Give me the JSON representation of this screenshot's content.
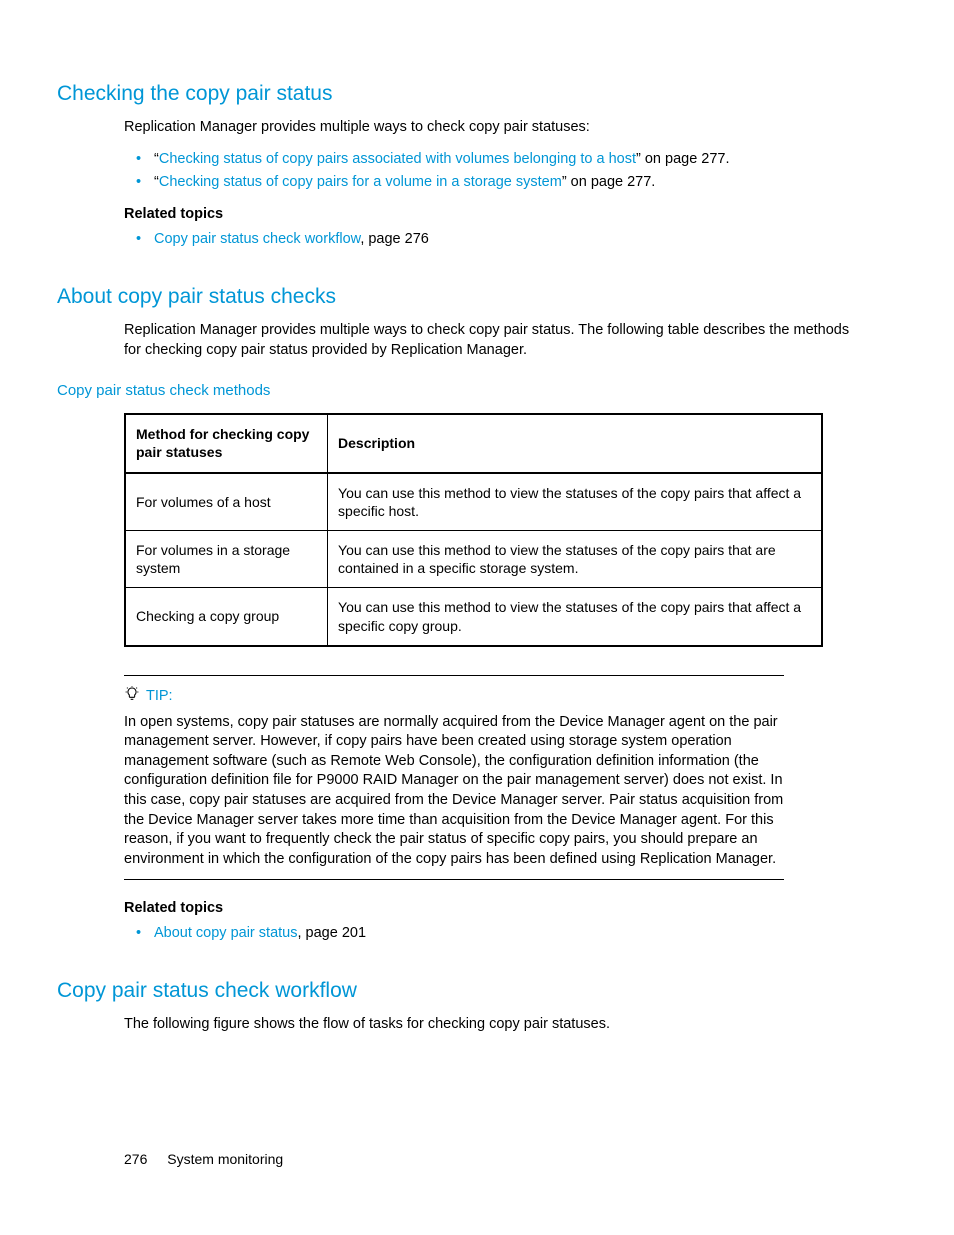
{
  "sec1": {
    "heading": "Checking the copy pair status",
    "intro": "Replication Manager provides multiple ways to check copy pair statuses:",
    "bullets": [
      {
        "pre": "“",
        "link": "Checking status of copy pairs associated with volumes belonging to a host",
        "post": "” on page 277."
      },
      {
        "pre": "“",
        "link": "Checking status of copy pairs for a volume in a storage system",
        "post": "” on page 277."
      }
    ],
    "rt_heading": "Related topics",
    "rt_items": [
      {
        "link": "Copy pair status check workflow",
        "post": ", page 276"
      }
    ]
  },
  "sec2": {
    "heading": "About copy pair status checks",
    "intro": "Replication Manager provides multiple ways to check copy pair status. The following table describes the methods for checking copy pair status provided by Replication Manager.",
    "table_caption": "Copy pair status check methods",
    "table": {
      "h1": "Method for checking copy pair statuses",
      "h2": "Description",
      "rows": [
        {
          "c1": "For volumes of a host",
          "c2": "You can use this method to view the statuses of the copy pairs that affect a specific host."
        },
        {
          "c1": "For volumes in a storage system",
          "c2": "You can use this method to view the statuses of the copy pairs that are contained in a specific storage system."
        },
        {
          "c1": "Checking a copy group",
          "c2": "You can use this method to view the statuses of the copy pairs that affect a specific copy group."
        }
      ]
    },
    "tip_label": "TIP:",
    "tip_text": "In open systems, copy pair statuses are normally acquired from the Device Manager agent on the pair management server. However, if copy pairs have been created using storage system operation management software (such as Remote Web Console), the configuration definition information (the configuration definition file for P9000 RAID Manager on the pair management server) does not exist. In this case, copy pair statuses are acquired from the Device Manager server. Pair status acquisition from the Device Manager server takes more time than acquisition from the Device Manager agent. For this reason, if you want to frequently check the pair status of specific copy pairs, you should prepare an environment in which the configuration of the copy pairs has been defined using Replication Manager.",
    "rt_heading": "Related topics",
    "rt_items": [
      {
        "link": "About copy pair status",
        "post": ", page 201"
      }
    ]
  },
  "sec3": {
    "heading": "Copy pair status check workflow",
    "intro": "The following figure shows the flow of tasks for checking copy pair statuses."
  },
  "footer": {
    "page": "276",
    "section": "System monitoring"
  }
}
